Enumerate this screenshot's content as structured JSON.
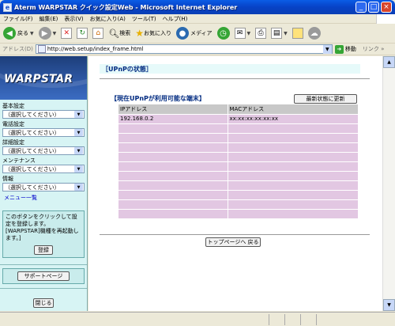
{
  "window": {
    "title": "Aterm WARPSTAR クイック設定Web - Microsoft Internet Explorer",
    "minimize": "_",
    "maximize": "□",
    "close": "×"
  },
  "menubar": [
    "ファイル(F)",
    "編集(E)",
    "表示(V)",
    "お気に入り(A)",
    "ツール(T)",
    "ヘルプ(H)"
  ],
  "toolbar": {
    "back": "戻る",
    "search": "検索",
    "favorites": "お気に入り",
    "media": "メディア"
  },
  "address": {
    "label": "アドレス(D)",
    "url": "http://web.setup/index_frame.html",
    "go": "移動",
    "links": "リンク »"
  },
  "sidebar": {
    "logo": "WARPSTAR",
    "sections": [
      {
        "label": "基本設定",
        "value": "（選択してください）"
      },
      {
        "label": "電話設定",
        "value": "（選択してください）"
      },
      {
        "label": "詳細設定",
        "value": "（選択してください）"
      },
      {
        "label": "メンテナンス",
        "value": "（選択してください）"
      },
      {
        "label": "情報",
        "value": "（選択してください）"
      }
    ],
    "menu_list": "メニュー一覧",
    "notice": "このボタンをクリックして設定を登録します。[WARPSTAR]機種を再起動します。]",
    "register_button": "登録",
    "support_button": "サポートページ",
    "close_button": "閉じる"
  },
  "main": {
    "title": "［UPnPの状態］",
    "subtitle": "【現在UPnPが利用可能な端末】",
    "refresh_button": "最新状態に更新",
    "columns": [
      "IPアドレス",
      "MACアドレス"
    ],
    "rows": [
      [
        "192.168.0.2",
        "xx:xx:xx:xx:xx:xx"
      ],
      [
        "",
        ""
      ],
      [
        "",
        ""
      ],
      [
        "",
        ""
      ],
      [
        "",
        ""
      ],
      [
        "",
        ""
      ],
      [
        "",
        ""
      ],
      [
        "",
        ""
      ],
      [
        "",
        ""
      ],
      [
        "",
        ""
      ],
      [
        "",
        ""
      ]
    ],
    "top_button": "トップページへ 戻る"
  }
}
